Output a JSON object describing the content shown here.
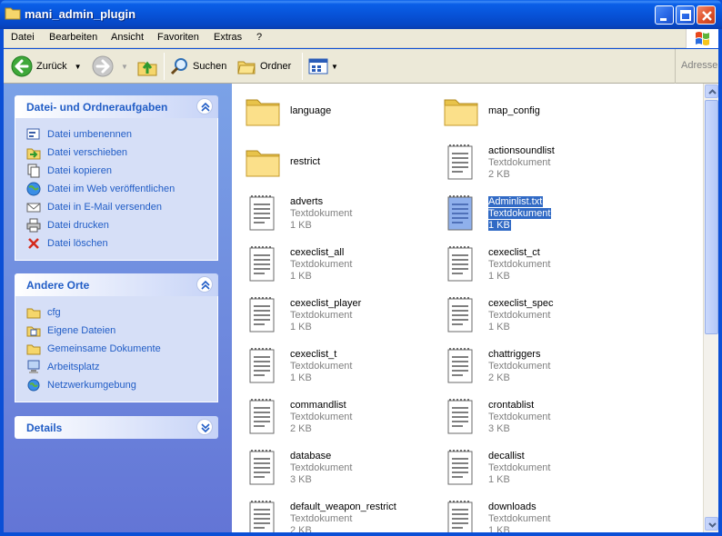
{
  "window": {
    "title": "mani_admin_plugin"
  },
  "menu": [
    "Datei",
    "Bearbeiten",
    "Ansicht",
    "Favoriten",
    "Extras",
    "?"
  ],
  "toolbar": {
    "back": "Zurück",
    "search": "Suchen",
    "folders": "Ordner",
    "address": "Adresse"
  },
  "tasks_panel": {
    "title": "Datei- und Ordneraufgaben",
    "items": [
      {
        "label": "Datei umbenennen",
        "icon": "rename-icon"
      },
      {
        "label": "Datei verschieben",
        "icon": "move-icon"
      },
      {
        "label": "Datei kopieren",
        "icon": "copy-icon"
      },
      {
        "label": "Datei im Web veröffentlichen",
        "icon": "publish-web-icon"
      },
      {
        "label": "Datei in E-Mail versenden",
        "icon": "email-icon"
      },
      {
        "label": "Datei drucken",
        "icon": "print-icon"
      },
      {
        "label": "Datei löschen",
        "icon": "delete-icon"
      }
    ]
  },
  "places_panel": {
    "title": "Andere Orte",
    "items": [
      {
        "label": "cfg",
        "icon": "folder-icon"
      },
      {
        "label": "Eigene Dateien",
        "icon": "my-documents-icon"
      },
      {
        "label": "Gemeinsame Dokumente",
        "icon": "shared-documents-icon"
      },
      {
        "label": "Arbeitsplatz",
        "icon": "my-computer-icon"
      },
      {
        "label": "Netzwerkumgebung",
        "icon": "network-icon"
      }
    ]
  },
  "details_panel": {
    "title": "Details"
  },
  "files": [
    {
      "name": "language",
      "kind": "folder"
    },
    {
      "name": "map_config",
      "kind": "folder"
    },
    {
      "name": "restrict",
      "kind": "folder"
    },
    {
      "name": "actionsoundlist",
      "kind": "text",
      "type": "Textdokument",
      "size": "2 KB"
    },
    {
      "name": "adverts",
      "kind": "text",
      "type": "Textdokument",
      "size": "1 KB"
    },
    {
      "name": "Adminlist.txt",
      "kind": "text",
      "type": "Textdokument",
      "size": "1 KB",
      "selected": true
    },
    {
      "name": "cexeclist_all",
      "kind": "text",
      "type": "Textdokument",
      "size": "1 KB"
    },
    {
      "name": "cexeclist_ct",
      "kind": "text",
      "type": "Textdokument",
      "size": "1 KB"
    },
    {
      "name": "cexeclist_player",
      "kind": "text",
      "type": "Textdokument",
      "size": "1 KB"
    },
    {
      "name": "cexeclist_spec",
      "kind": "text",
      "type": "Textdokument",
      "size": "1 KB"
    },
    {
      "name": "cexeclist_t",
      "kind": "text",
      "type": "Textdokument",
      "size": "1 KB"
    },
    {
      "name": "chattriggers",
      "kind": "text",
      "type": "Textdokument",
      "size": "2 KB"
    },
    {
      "name": "commandlist",
      "kind": "text",
      "type": "Textdokument",
      "size": "2 KB"
    },
    {
      "name": "crontablist",
      "kind": "text",
      "type": "Textdokument",
      "size": "3 KB"
    },
    {
      "name": "database",
      "kind": "text",
      "type": "Textdokument",
      "size": "3 KB"
    },
    {
      "name": "decallist",
      "kind": "text",
      "type": "Textdokument",
      "size": "1 KB"
    },
    {
      "name": "default_weapon_restrict",
      "kind": "text",
      "type": "Textdokument",
      "size": "2 KB"
    },
    {
      "name": "downloads",
      "kind": "text",
      "type": "Textdokument",
      "size": "1 KB"
    }
  ]
}
